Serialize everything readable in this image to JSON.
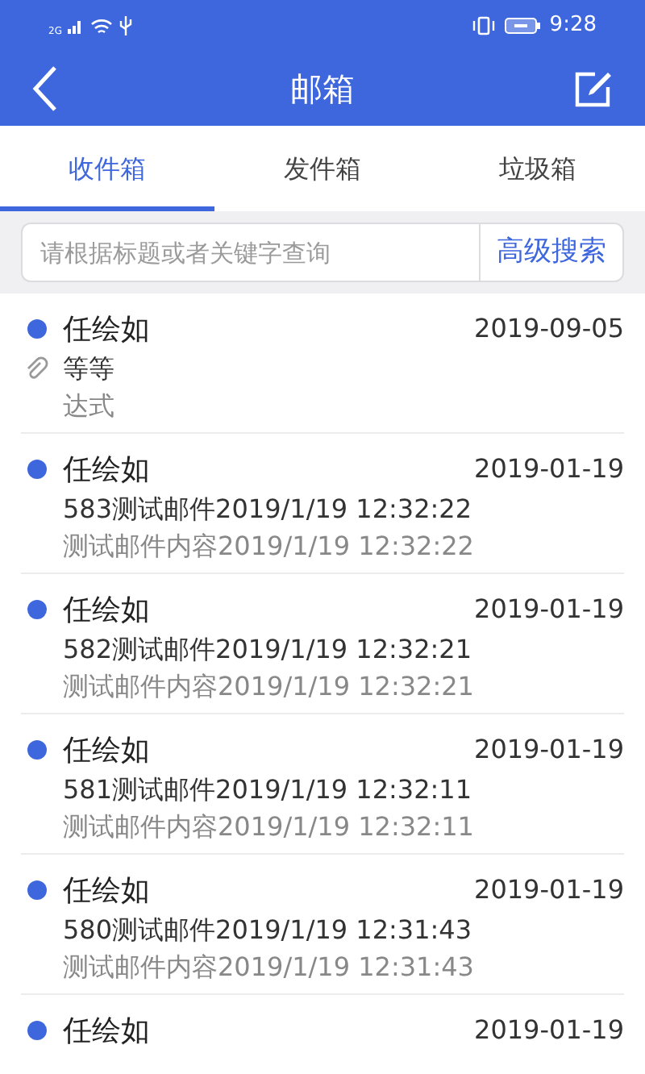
{
  "status_bar": {
    "time": "9:28",
    "network": "2G"
  },
  "header": {
    "title": "邮箱"
  },
  "tabs": [
    {
      "label": "收件箱",
      "selected": true
    },
    {
      "label": "发件箱",
      "selected": false
    },
    {
      "label": "垃圾箱",
      "selected": false
    }
  ],
  "search": {
    "placeholder": "请根据标题或者关键字查询",
    "button": "高级搜索"
  },
  "messages": [
    {
      "sender": "任绘如",
      "date": "2019-09-05",
      "subject": "等等",
      "preview": "达式",
      "unread": true,
      "attachment": true
    },
    {
      "sender": "任绘如",
      "date": "2019-01-19",
      "subject": "583测试邮件2019/1/19 12:32:22",
      "preview": "测试邮件内容2019/1/19 12:32:22",
      "unread": true,
      "attachment": false
    },
    {
      "sender": "任绘如",
      "date": "2019-01-19",
      "subject": "582测试邮件2019/1/19 12:32:21",
      "preview": "测试邮件内容2019/1/19 12:32:21",
      "unread": true,
      "attachment": false
    },
    {
      "sender": "任绘如",
      "date": "2019-01-19",
      "subject": "581测试邮件2019/1/19 12:32:11",
      "preview": "测试邮件内容2019/1/19 12:32:11",
      "unread": true,
      "attachment": false
    },
    {
      "sender": "任绘如",
      "date": "2019-01-19",
      "subject": "580测试邮件2019/1/19 12:31:43",
      "preview": "测试邮件内容2019/1/19 12:31:43",
      "unread": true,
      "attachment": false
    },
    {
      "sender": "任绘如",
      "date": "2019-01-19",
      "unread": true,
      "attachment": false
    }
  ]
}
